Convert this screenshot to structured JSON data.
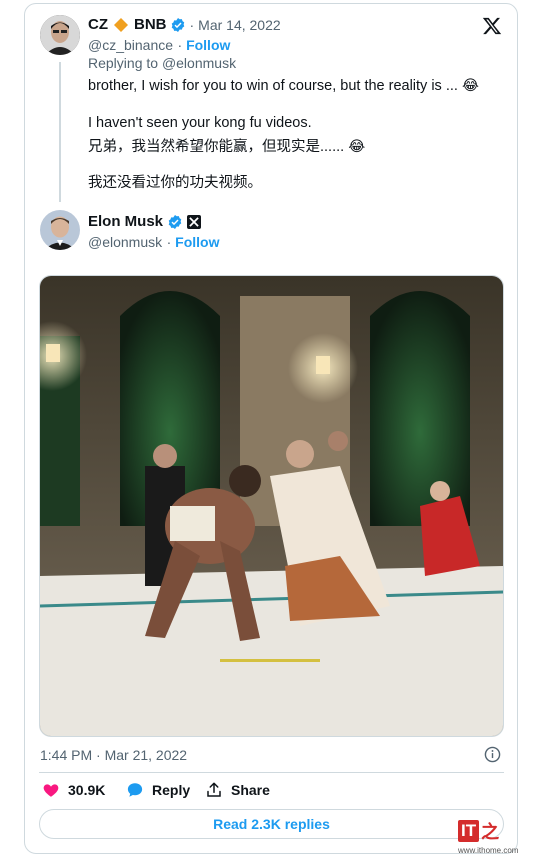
{
  "quoted_tweet": {
    "author_name": "CZ",
    "author_suffix": "BNB",
    "handle": "@cz_binance",
    "date": "Mar 14, 2022",
    "follow_label": "Follow",
    "replying_prefix": "Replying to ",
    "replying_to": "@elonmusk",
    "lines": [
      "brother, I wish for you to win of course, but the reality is ... 😂",
      "I haven't seen your kong fu videos.",
      "兄弟，我当然希望你能赢，但现实是...... 😂",
      "我还没看过你的功夫视频。"
    ]
  },
  "main_tweet": {
    "author_name": "Elon Musk",
    "handle": "@elonmusk",
    "follow_label": "Follow",
    "timestamp": "1:44 PM · Mar 21, 2022"
  },
  "actions": {
    "likes": "30.9K",
    "reply_label": "Reply",
    "share_label": "Share",
    "read_replies_label": "Read 2.3K replies"
  },
  "watermark": {
    "brand": "IT之家",
    "url": "www.ithome.com"
  },
  "colors": {
    "accent": "#1d9bf0",
    "like": "#f91880",
    "border": "#cfd9de",
    "muted": "#536471"
  },
  "icons": [
    "x-logo-icon",
    "verified-badge-icon",
    "bnb-diamond-icon",
    "info-icon",
    "heart-icon",
    "reply-bubble-icon",
    "share-icon"
  ]
}
